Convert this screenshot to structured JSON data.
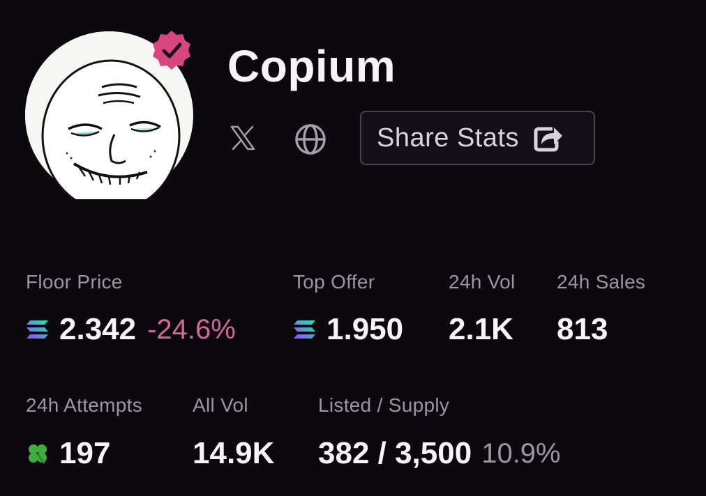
{
  "collection": {
    "name": "Copium",
    "avatar_icon": "copium-face-avatar",
    "verified_icon": "verified-check-badge",
    "verified_color": "#d9457f"
  },
  "links": {
    "x_icon": "x-logo",
    "globe_icon": "globe"
  },
  "share": {
    "label": "Share Stats",
    "icon": "share-external"
  },
  "stats": {
    "floor_price": {
      "label": "Floor Price",
      "value": "2.342",
      "change": "-24.6%",
      "currency_icon": "solana"
    },
    "top_offer": {
      "label": "Top Offer",
      "value": "1.950",
      "currency_icon": "solana"
    },
    "vol_24h": {
      "label": "24h Vol",
      "value": "2.1K"
    },
    "sales_24h": {
      "label": "24h Sales",
      "value": "813"
    },
    "attempts_24h": {
      "label": "24h Attempts",
      "value": "197",
      "icon": "four-leaf-clover"
    },
    "all_vol": {
      "label": "All Vol",
      "value": "14.9K"
    },
    "listed_supply": {
      "label": "Listed / Supply",
      "value": "382 / 3,500",
      "percent": "10.9%"
    }
  },
  "colors": {
    "background": "#0b090d",
    "negative": "#d86694",
    "muted": "#9d95a5"
  }
}
